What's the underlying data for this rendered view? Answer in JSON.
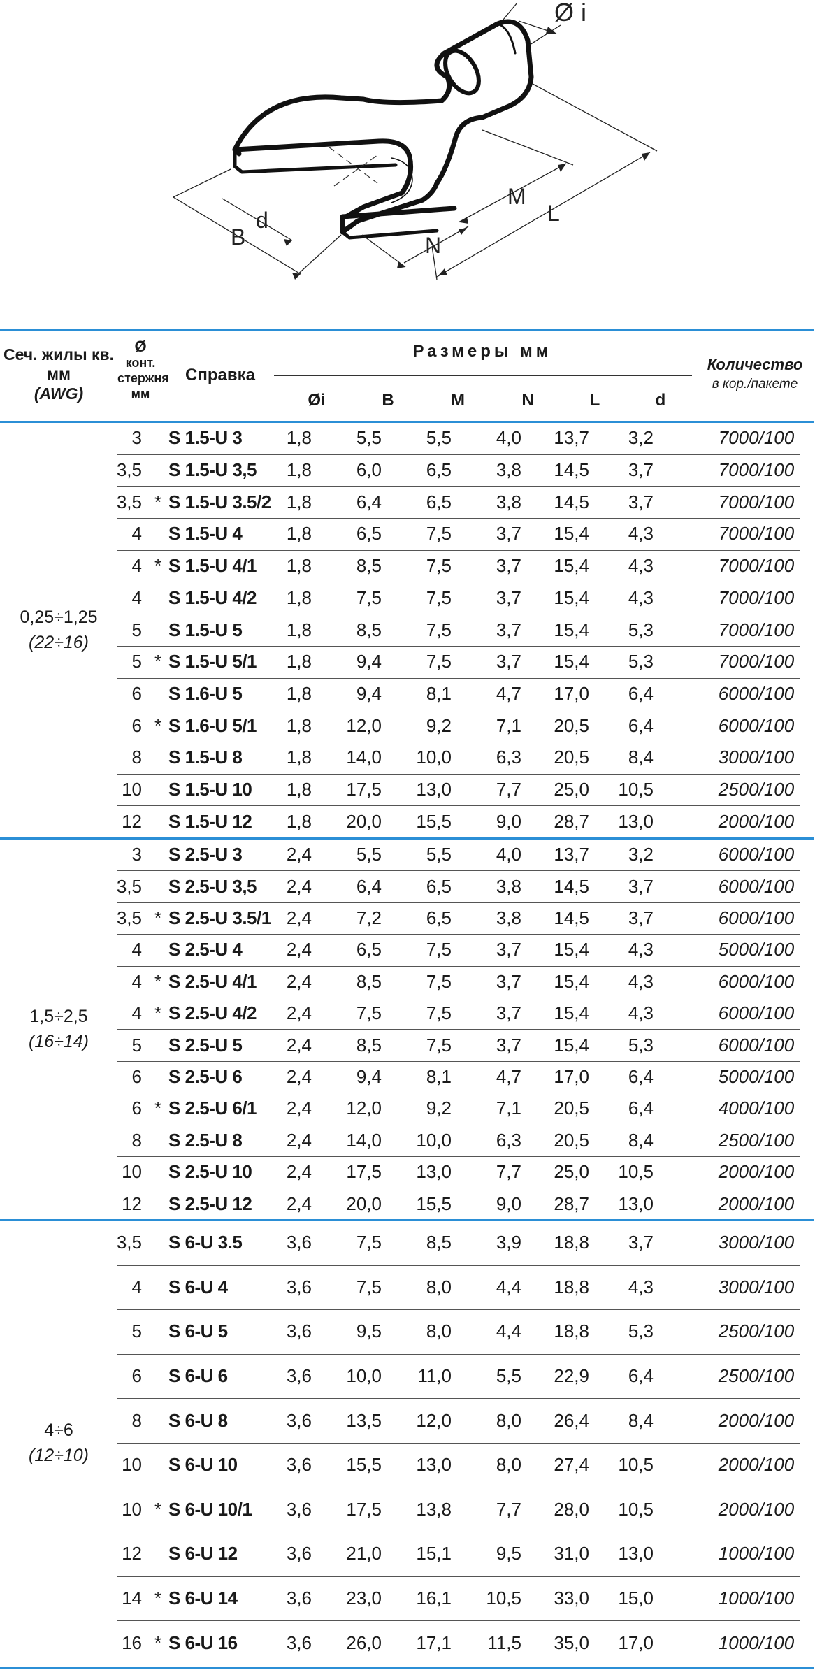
{
  "diagram": {
    "labels": {
      "di": "Ø i",
      "B": "B",
      "d": "d",
      "M": "M",
      "N": "N",
      "L": "L"
    }
  },
  "header": {
    "section": "Сеч. жилы кв. мм",
    "section_awg": "(AWG)",
    "stud_symbol": "Ø",
    "stud": "конт. стержня мм",
    "ref": "Справка",
    "dims_title": "Размеры мм",
    "dims": [
      "Øi",
      "B",
      "M",
      "N",
      "L",
      "d"
    ],
    "qty": "Количество",
    "qty_sub": "в кор./пакете"
  },
  "groups": [
    {
      "section": "0,25÷1,25",
      "awg": "(22÷16)",
      "rows": [
        {
          "stud": "3",
          "star": "",
          "ref": "S 1.5-U 3",
          "di": "1,8",
          "B": "5,5",
          "M": "5,5",
          "N": "4,0",
          "L": "13,7",
          "d": "3,2",
          "qty": "7000/100"
        },
        {
          "stud": "3,5",
          "star": "",
          "ref": "S 1.5-U 3,5",
          "di": "1,8",
          "B": "6,0",
          "M": "6,5",
          "N": "3,8",
          "L": "14,5",
          "d": "3,7",
          "qty": "7000/100"
        },
        {
          "stud": "3,5",
          "star": "*",
          "ref": "S 1.5-U 3.5/2",
          "di": "1,8",
          "B": "6,4",
          "M": "6,5",
          "N": "3,8",
          "L": "14,5",
          "d": "3,7",
          "qty": "7000/100"
        },
        {
          "stud": "4",
          "star": "",
          "ref": "S 1.5-U 4",
          "di": "1,8",
          "B": "6,5",
          "M": "7,5",
          "N": "3,7",
          "L": "15,4",
          "d": "4,3",
          "qty": "7000/100"
        },
        {
          "stud": "4",
          "star": "*",
          "ref": "S 1.5-U 4/1",
          "di": "1,8",
          "B": "8,5",
          "M": "7,5",
          "N": "3,7",
          "L": "15,4",
          "d": "4,3",
          "qty": "7000/100"
        },
        {
          "stud": "4",
          "star": "",
          "ref": "S 1.5-U 4/2",
          "di": "1,8",
          "B": "7,5",
          "M": "7,5",
          "N": "3,7",
          "L": "15,4",
          "d": "4,3",
          "qty": "7000/100"
        },
        {
          "stud": "5",
          "star": "",
          "ref": "S 1.5-U 5",
          "di": "1,8",
          "B": "8,5",
          "M": "7,5",
          "N": "3,7",
          "L": "15,4",
          "d": "5,3",
          "qty": "7000/100"
        },
        {
          "stud": "5",
          "star": "*",
          "ref": "S 1.5-U 5/1",
          "di": "1,8",
          "B": "9,4",
          "M": "7,5",
          "N": "3,7",
          "L": "15,4",
          "d": "5,3",
          "qty": "7000/100"
        },
        {
          "stud": "6",
          "star": "",
          "ref": "S 1.6-U 5",
          "di": "1,8",
          "B": "9,4",
          "M": "8,1",
          "N": "4,7",
          "L": "17,0",
          "d": "6,4",
          "qty": "6000/100"
        },
        {
          "stud": "6",
          "star": "*",
          "ref": "S 1.6-U 5/1",
          "di": "1,8",
          "B": "12,0",
          "M": "9,2",
          "N": "7,1",
          "L": "20,5",
          "d": "6,4",
          "qty": "6000/100"
        },
        {
          "stud": "8",
          "star": "",
          "ref": "S 1.5-U 8",
          "di": "1,8",
          "B": "14,0",
          "M": "10,0",
          "N": "6,3",
          "L": "20,5",
          "d": "8,4",
          "qty": "3000/100"
        },
        {
          "stud": "10",
          "star": "",
          "ref": "S 1.5-U 10",
          "di": "1,8",
          "B": "17,5",
          "M": "13,0",
          "N": "7,7",
          "L": "25,0",
          "d": "10,5",
          "qty": "2500/100"
        },
        {
          "stud": "12",
          "star": "",
          "ref": "S 1.5-U 12",
          "di": "1,8",
          "B": "20,0",
          "M": "15,5",
          "N": "9,0",
          "L": "28,7",
          "d": "13,0",
          "qty": "2000/100"
        }
      ]
    },
    {
      "section": "1,5÷2,5",
      "awg": "(16÷14)",
      "rows": [
        {
          "stud": "3",
          "star": "",
          "ref": "S 2.5-U 3",
          "di": "2,4",
          "B": "5,5",
          "M": "5,5",
          "N": "4,0",
          "L": "13,7",
          "d": "3,2",
          "qty": "6000/100"
        },
        {
          "stud": "3,5",
          "star": "",
          "ref": "S 2.5-U 3,5",
          "di": "2,4",
          "B": "6,4",
          "M": "6,5",
          "N": "3,8",
          "L": "14,5",
          "d": "3,7",
          "qty": "6000/100"
        },
        {
          "stud": "3,5",
          "star": "*",
          "ref": "S 2.5-U 3.5/1",
          "di": "2,4",
          "B": "7,2",
          "M": "6,5",
          "N": "3,8",
          "L": "14,5",
          "d": "3,7",
          "qty": "6000/100"
        },
        {
          "stud": "4",
          "star": "",
          "ref": "S 2.5-U 4",
          "di": "2,4",
          "B": "6,5",
          "M": "7,5",
          "N": "3,7",
          "L": "15,4",
          "d": "4,3",
          "qty": "5000/100"
        },
        {
          "stud": "4",
          "star": "*",
          "ref": "S 2.5-U 4/1",
          "di": "2,4",
          "B": "8,5",
          "M": "7,5",
          "N": "3,7",
          "L": "15,4",
          "d": "4,3",
          "qty": "6000/100"
        },
        {
          "stud": "4",
          "star": "*",
          "ref": "S 2.5-U 4/2",
          "di": "2,4",
          "B": "7,5",
          "M": "7,5",
          "N": "3,7",
          "L": "15,4",
          "d": "4,3",
          "qty": "6000/100"
        },
        {
          "stud": "5",
          "star": "",
          "ref": "S 2.5-U 5",
          "di": "2,4",
          "B": "8,5",
          "M": "7,5",
          "N": "3,7",
          "L": "15,4",
          "d": "5,3",
          "qty": "6000/100"
        },
        {
          "stud": "6",
          "star": "",
          "ref": "S 2.5-U 6",
          "di": "2,4",
          "B": "9,4",
          "M": "8,1",
          "N": "4,7",
          "L": "17,0",
          "d": "6,4",
          "qty": "5000/100"
        },
        {
          "stud": "6",
          "star": "*",
          "ref": "S 2.5-U 6/1",
          "di": "2,4",
          "B": "12,0",
          "M": "9,2",
          "N": "7,1",
          "L": "20,5",
          "d": "6,4",
          "qty": "4000/100"
        },
        {
          "stud": "8",
          "star": "",
          "ref": "S 2.5-U 8",
          "di": "2,4",
          "B": "14,0",
          "M": "10,0",
          "N": "6,3",
          "L": "20,5",
          "d": "8,4",
          "qty": "2500/100"
        },
        {
          "stud": "10",
          "star": "",
          "ref": "S 2.5-U 10",
          "di": "2,4",
          "B": "17,5",
          "M": "13,0",
          "N": "7,7",
          "L": "25,0",
          "d": "10,5",
          "qty": "2000/100"
        },
        {
          "stud": "12",
          "star": "",
          "ref": "S 2.5-U 12",
          "di": "2,4",
          "B": "20,0",
          "M": "15,5",
          "N": "9,0",
          "L": "28,7",
          "d": "13,0",
          "qty": "2000/100"
        }
      ]
    },
    {
      "section": "4÷6",
      "awg": "(12÷10)",
      "rows": [
        {
          "stud": "3,5",
          "star": "",
          "ref": "S 6-U 3.5",
          "di": "3,6",
          "B": "7,5",
          "M": "8,5",
          "N": "3,9",
          "L": "18,8",
          "d": "3,7",
          "qty": "3000/100"
        },
        {
          "stud": "4",
          "star": "",
          "ref": "S 6-U 4",
          "di": "3,6",
          "B": "7,5",
          "M": "8,0",
          "N": "4,4",
          "L": "18,8",
          "d": "4,3",
          "qty": "3000/100"
        },
        {
          "stud": "5",
          "star": "",
          "ref": "S 6-U 5",
          "di": "3,6",
          "B": "9,5",
          "M": "8,0",
          "N": "4,4",
          "L": "18,8",
          "d": "5,3",
          "qty": "2500/100"
        },
        {
          "stud": "6",
          "star": "",
          "ref": "S 6-U 6",
          "di": "3,6",
          "B": "10,0",
          "M": "11,0",
          "N": "5,5",
          "L": "22,9",
          "d": "6,4",
          "qty": "2500/100"
        },
        {
          "stud": "8",
          "star": "",
          "ref": "S 6-U 8",
          "di": "3,6",
          "B": "13,5",
          "M": "12,0",
          "N": "8,0",
          "L": "26,4",
          "d": "8,4",
          "qty": "2000/100"
        },
        {
          "stud": "10",
          "star": "",
          "ref": "S 6-U 10",
          "di": "3,6",
          "B": "15,5",
          "M": "13,0",
          "N": "8,0",
          "L": "27,4",
          "d": "10,5",
          "qty": "2000/100"
        },
        {
          "stud": "10",
          "star": "*",
          "ref": "S 6-U 10/1",
          "di": "3,6",
          "B": "17,5",
          "M": "13,8",
          "N": "7,7",
          "L": "28,0",
          "d": "10,5",
          "qty": "2000/100"
        },
        {
          "stud": "12",
          "star": "",
          "ref": "S 6-U 12",
          "di": "3,6",
          "B": "21,0",
          "M": "15,1",
          "N": "9,5",
          "L": "31,0",
          "d": "13,0",
          "qty": "1000/100"
        },
        {
          "stud": "14",
          "star": "*",
          "ref": "S 6-U 14",
          "di": "3,6",
          "B": "23,0",
          "M": "16,1",
          "N": "10,5",
          "L": "33,0",
          "d": "15,0",
          "qty": "1000/100"
        },
        {
          "stud": "16",
          "star": "*",
          "ref": "S 6-U 16",
          "di": "3,6",
          "B": "26,0",
          "M": "17,1",
          "N": "11,5",
          "L": "35,0",
          "d": "17,0",
          "qty": "1000/100"
        }
      ]
    }
  ]
}
